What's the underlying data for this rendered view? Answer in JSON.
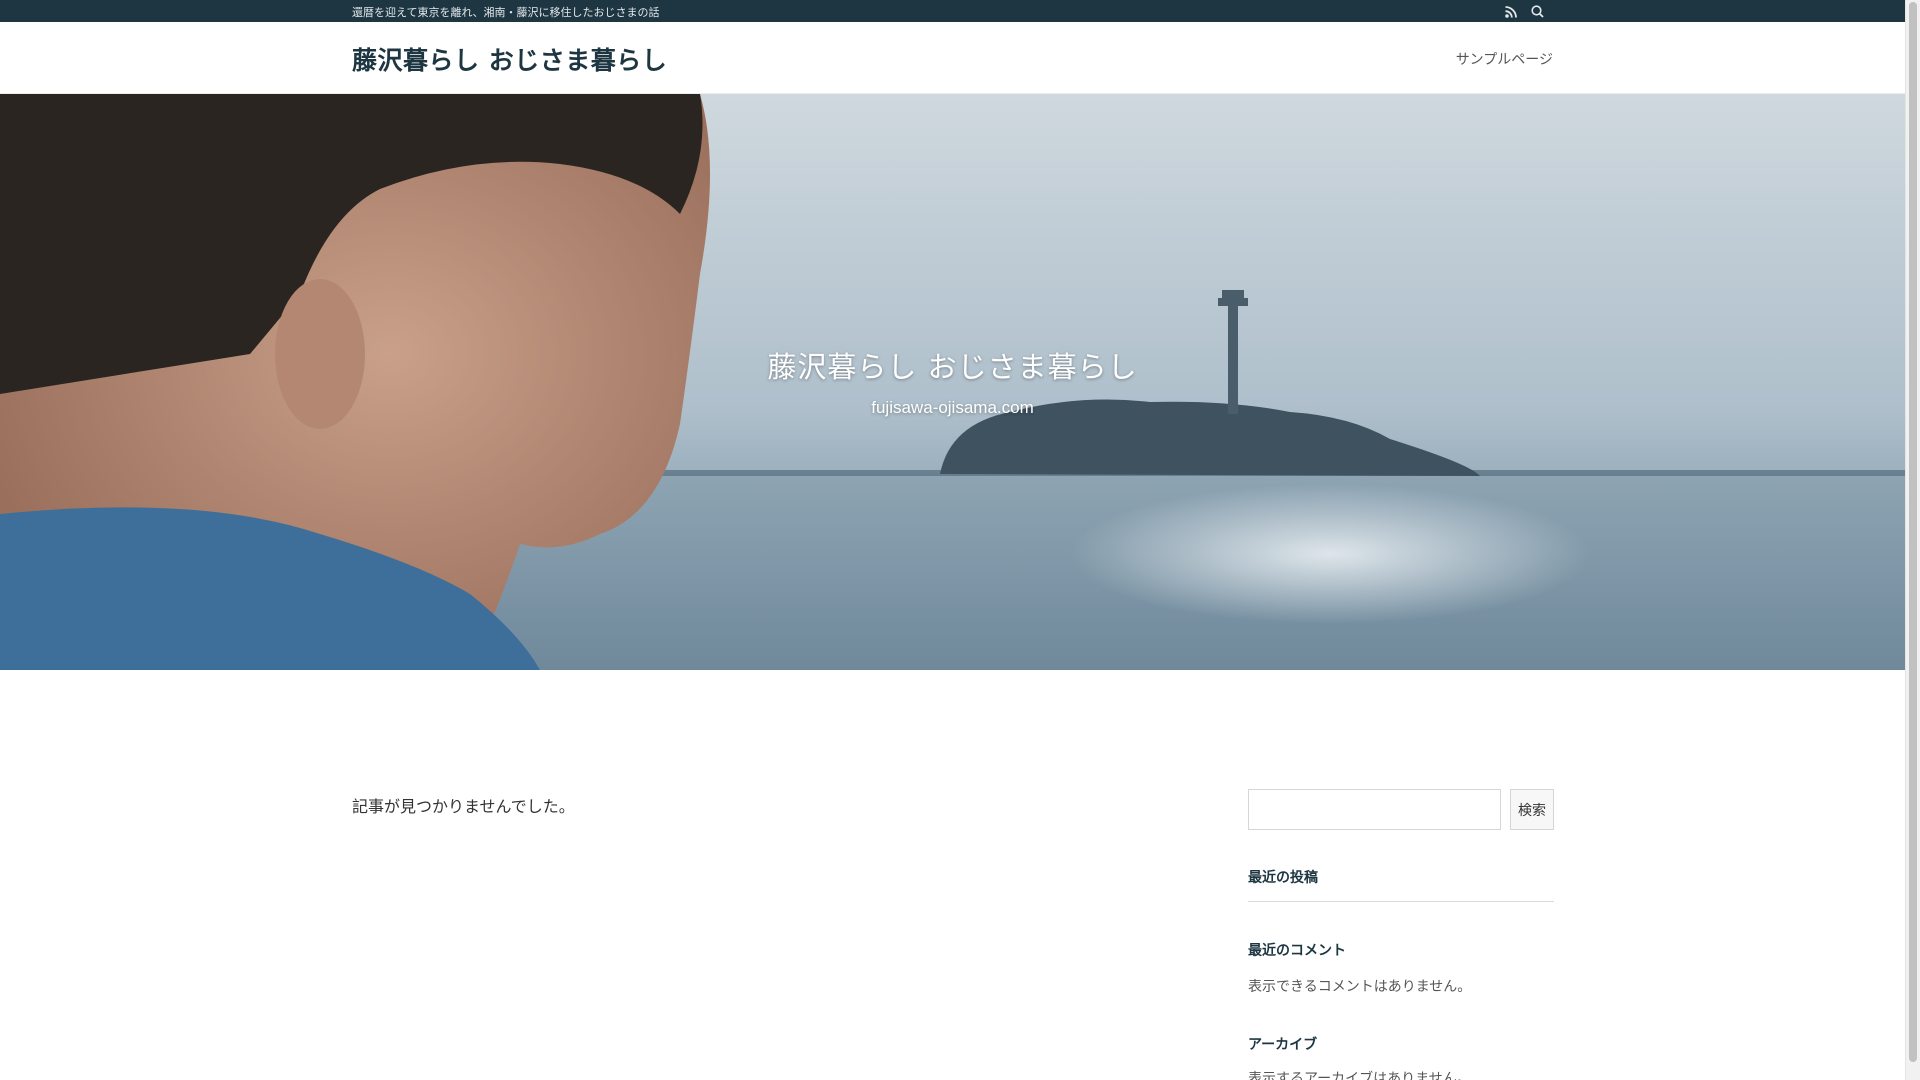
{
  "topbar": {
    "tagline": "還暦を迎えて東京を離れ、湘南・藤沢に移住したおじさまの話",
    "icons": [
      "rss-icon",
      "search-icon"
    ]
  },
  "header": {
    "site_title": "藤沢暮らし おじさま暮らし",
    "nav": [
      {
        "label": "サンプルページ"
      }
    ]
  },
  "hero": {
    "title": "藤沢暮らし おじさま暮らし",
    "subtitle": "fujisawa-ojisama.com"
  },
  "main": {
    "no_posts_message": "記事が見つかりませんでした。"
  },
  "sidebar": {
    "search": {
      "value": "",
      "button_label": "検索"
    },
    "recent_posts": {
      "title": "最近の投稿"
    },
    "recent_comments": {
      "title": "最近のコメント",
      "empty_text": "表示できるコメントはありません。"
    },
    "archives": {
      "title": "アーカイブ",
      "empty_text": "表示するアーカイブはありません。"
    }
  },
  "colors": {
    "topbar_bg": "#1d3642",
    "title_color": "#1d3642",
    "hero_sky": "#aebfcb",
    "hero_sea": "#7d96a7"
  }
}
